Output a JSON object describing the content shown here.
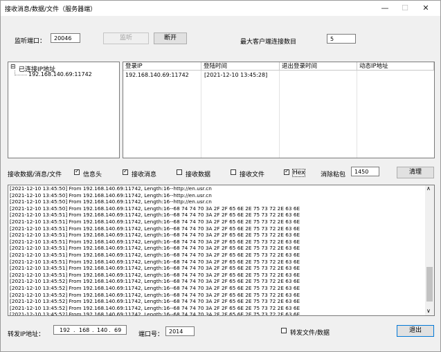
{
  "window": {
    "title": "接收消息/数据/文件（服务器端）",
    "controls": {
      "minimize": "—",
      "maximize": "☐",
      "close": "✕"
    }
  },
  "listen": {
    "port_label": "监听端口：",
    "port_value": "20046",
    "listen_button": "监听",
    "disconnect_button": "断开",
    "max_clients_label": "最大客户端连接数目",
    "max_clients_value": "5"
  },
  "tree": {
    "root_label": "已连接IP地址",
    "expander": "⊟",
    "items": [
      "192.168.140.69:11742"
    ]
  },
  "connections": {
    "headers": [
      "登录IP",
      "登陆时间",
      "退出登录时间",
      "动态IP地址"
    ],
    "rows": [
      [
        "192.168.140.69:11742",
        "[2021-12-10 13:45:28]",
        "",
        ""
      ]
    ]
  },
  "options": {
    "section_label": "接收数据/消息/文件",
    "info_header": "信息头",
    "receive_msg": "接收消息",
    "receive_data": "接收数据",
    "receive_file": "接收文件",
    "hex": "Hex",
    "sticky_label": "消除粘包",
    "sticky_value": "1450",
    "clear_button": "清理",
    "checked": {
      "info_header": true,
      "receive_msg": true,
      "receive_data": false,
      "receive_file": false,
      "hex": true
    }
  },
  "log": {
    "lines": [
      "[2021-12-10 13:45:50] From 192.168.140.69:11742, Length:16--http://en.usr.cn",
      "[2021-12-10 13:45:50] From 192.168.140.69:11742, Length:16--http://en.usr.cn",
      "[2021-12-10 13:45:50] From 192.168.140.69:11742, Length:16--http://en.usr.cn",
      "[2021-12-10 13:45:50] From 192.168.140.69:11742, Length:16--68 74 74 70 3A 2F 2F 65 6E 2E 75 73 72 2E 63 6E",
      "[2021-12-10 13:45:51] From 192.168.140.69:11742, Length:16--68 74 74 70 3A 2F 2F 65 6E 2E 75 73 72 2E 63 6E",
      "[2021-12-10 13:45:51] From 192.168.140.69:11742, Length:16--68 74 74 70 3A 2F 2F 65 6E 2E 75 73 72 2E 63 6E",
      "[2021-12-10 13:45:51] From 192.168.140.69:11742, Length:16--68 74 74 70 3A 2F 2F 65 6E 2E 75 73 72 2E 63 6E",
      "[2021-12-10 13:45:51] From 192.168.140.69:11742, Length:16--68 74 74 70 3A 2F 2F 65 6E 2E 75 73 72 2E 63 6E",
      "[2021-12-10 13:45:51] From 192.168.140.69:11742, Length:16--68 74 74 70 3A 2F 2F 65 6E 2E 75 73 72 2E 63 6E",
      "[2021-12-10 13:45:51] From 192.168.140.69:11742, Length:16--68 74 74 70 3A 2F 2F 65 6E 2E 75 73 72 2E 63 6E",
      "[2021-12-10 13:45:51] From 192.168.140.69:11742, Length:16--68 74 74 70 3A 2F 2F 65 6E 2E 75 73 72 2E 63 6E",
      "[2021-12-10 13:45:51] From 192.168.140.69:11742, Length:16--68 74 74 70 3A 2F 2F 65 6E 2E 75 73 72 2E 63 6E",
      "[2021-12-10 13:45:51] From 192.168.140.69:11742, Length:16--68 74 74 70 3A 2F 2F 65 6E 2E 75 73 72 2E 63 6E",
      "[2021-12-10 13:45:51] From 192.168.140.69:11742, Length:16--68 74 74 70 3A 2F 2F 65 6E 2E 75 73 72 2E 63 6E",
      "[2021-12-10 13:45:52] From 192.168.140.69:11742, Length:16--68 74 74 70 3A 2F 2F 65 6E 2E 75 73 72 2E 63 6E",
      "[2021-12-10 13:45:52] From 192.168.140.69:11742, Length:16--68 74 74 70 3A 2F 2F 65 6E 2E 75 73 72 2E 63 6E",
      "[2021-12-10 13:45:52] From 192.168.140.69:11742, Length:16--68 74 74 70 3A 2F 2F 65 6E 2E 75 73 72 2E 63 6E",
      "[2021-12-10 13:45:52] From 192.168.140.69:11742, Length:16--68 74 74 70 3A 2F 2F 65 6E 2E 75 73 72 2E 63 6E",
      "[2021-12-10 13:45:52] From 192.168.140.69:11742, Length:16--68 74 74 70 3A 2F 2F 65 6E 2E 75 73 72 2E 63 6E",
      "[2021-12-10 13:45:52] From 192.168.140.69:11742, Length:16--68 74 74 70 3A 2F 2F 65 6E 2E 75 73 72 2E 63 6E"
    ],
    "scroll_up": "∧",
    "scroll_down": "∨"
  },
  "forward": {
    "ip_label": "转发IP地址：",
    "ip_parts": [
      "192",
      "168",
      "140",
      "69"
    ],
    "ip_dot": ".",
    "port_label": "端口号：",
    "port_value": "2014",
    "forward_label": "转发文件/数据",
    "exit_button": "退出"
  }
}
